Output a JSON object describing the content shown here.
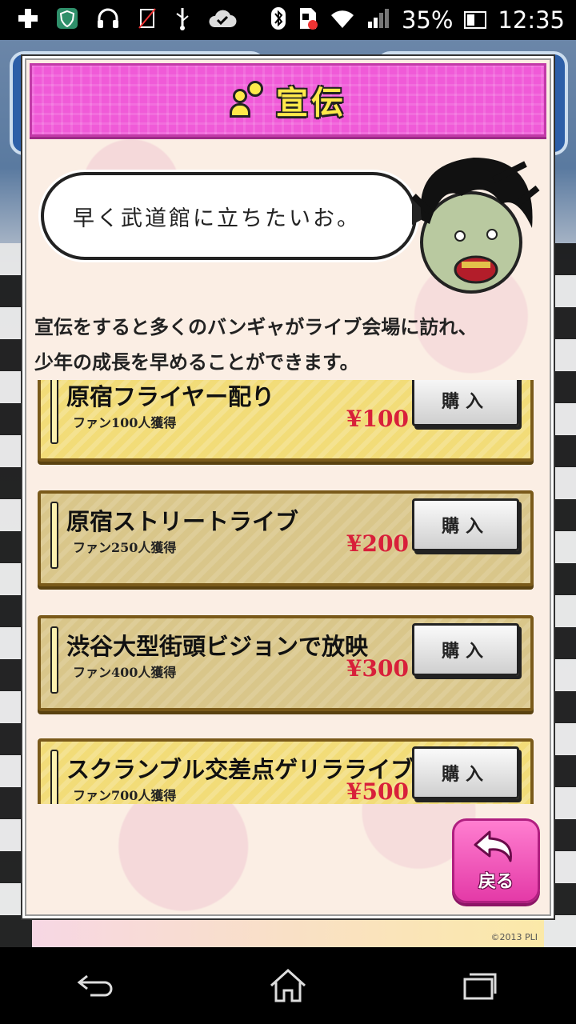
{
  "status_bar": {
    "battery_percent": "35%",
    "time": "12:35",
    "icons": [
      "plus-icon",
      "shield-app-icon",
      "headphones-icon",
      "no-sim-icon",
      "usb-icon",
      "cloud-check-icon",
      "bluetooth-icon",
      "sd-card-icon",
      "wifi-icon",
      "signal-icon",
      "battery-icon"
    ]
  },
  "dialog": {
    "title": "宣伝",
    "speech": "早く武道館に立ちたいお。",
    "intro_line1": "宣伝をすると多くのバンギャがライブ会場に訪れ、",
    "intro_line2": "少年の成長を早めることができます。",
    "buy_label": "購入",
    "items": [
      {
        "name": "原宿フライヤー配り",
        "fans": "ファン100人獲得",
        "price": "¥100"
      },
      {
        "name": "原宿ストリートライブ",
        "fans": "ファン250人獲得",
        "price": "¥200"
      },
      {
        "name": "渋谷大型街頭ビジョンで放映",
        "fans": "ファン400人獲得",
        "price": "¥300"
      },
      {
        "name": "スクランブル交差点ゲリラライブ",
        "fans": "ファン700人獲得",
        "price": "¥500"
      }
    ],
    "back_label": "戻る"
  },
  "background": {
    "banner_copyright": "©2013 PLI"
  },
  "colors": {
    "title_bar": "#f05ad8",
    "title_text": "#ffe94a",
    "item_bg": "#f2dc78",
    "price": "#d8203a",
    "back_button": "#e43aa7"
  }
}
